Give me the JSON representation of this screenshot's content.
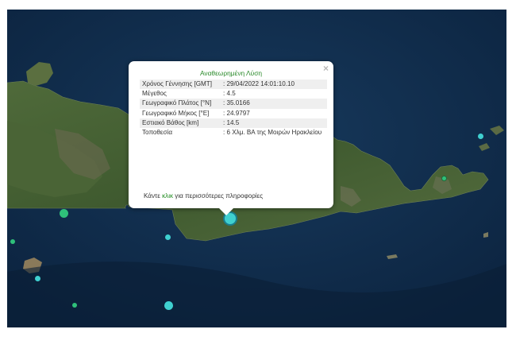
{
  "popup": {
    "title": "Αναθεωρημένη Λύση",
    "close_glyph": "×",
    "rows": [
      {
        "label": "Χρόνος Γέννησης [GMT]",
        "value": ": 29/04/2022 14:01:10.10"
      },
      {
        "label": "Μέγεθος",
        "value": ": 4.5"
      },
      {
        "label": "Γεωγραφικό Πλάτος [°N]",
        "value": ": 35.0166"
      },
      {
        "label": "Γεωγραφικό Μήκος [°E]",
        "value": ": 24.9797"
      },
      {
        "label": "Εστιακό Βάθος [km]",
        "value": ": 14.5"
      },
      {
        "label": "Τοποθεσία",
        "value": ": 6 Χλμ. ΒΑ της Μοιρών Ηρακλείου"
      }
    ],
    "footer_before": "Κάντε ",
    "footer_link": "κλικ",
    "footer_after": " για περισσότερες πληροφορίες"
  },
  "markers": [
    {
      "name": "main-event",
      "color": "#3fd0d0"
    },
    {
      "name": "event-west-sea",
      "color": "#2fc07a"
    },
    {
      "name": "event-south-west",
      "color": "#2fc07a"
    },
    {
      "name": "event-south",
      "color": "#3fd0d0"
    },
    {
      "name": "event-gavdos",
      "color": "#3fd0d0"
    },
    {
      "name": "event-east",
      "color": "#3fd0d0"
    },
    {
      "name": "event-east-inland",
      "color": "#2fc07a"
    },
    {
      "name": "event-far-south-west",
      "color": "#2fc07a"
    },
    {
      "name": "event-south-sea",
      "color": "#3fd0d0"
    }
  ]
}
